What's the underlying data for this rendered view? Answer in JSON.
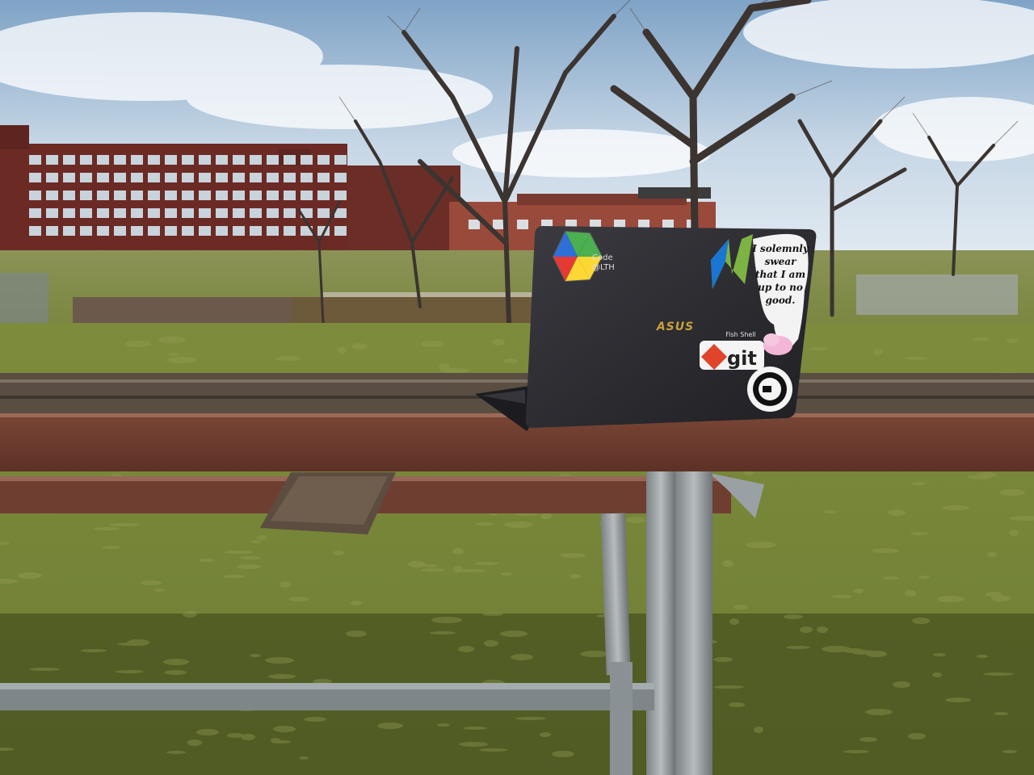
{
  "laptop": {
    "brand": "ASUS",
    "stickers": {
      "code_lth": "Code\n@LTH",
      "solemnly_swear": [
        "I solemnly",
        "swear",
        "that I am",
        "up to no",
        "good."
      ],
      "fish_shell": "Fish Shell",
      "git": "git"
    }
  },
  "colors": {
    "sky": "#c9d9e8",
    "grass": "#7f8a3e",
    "building": "#6b2b24",
    "table_top": "#6e3b2c",
    "laptop_lid": "#2b2b30"
  }
}
